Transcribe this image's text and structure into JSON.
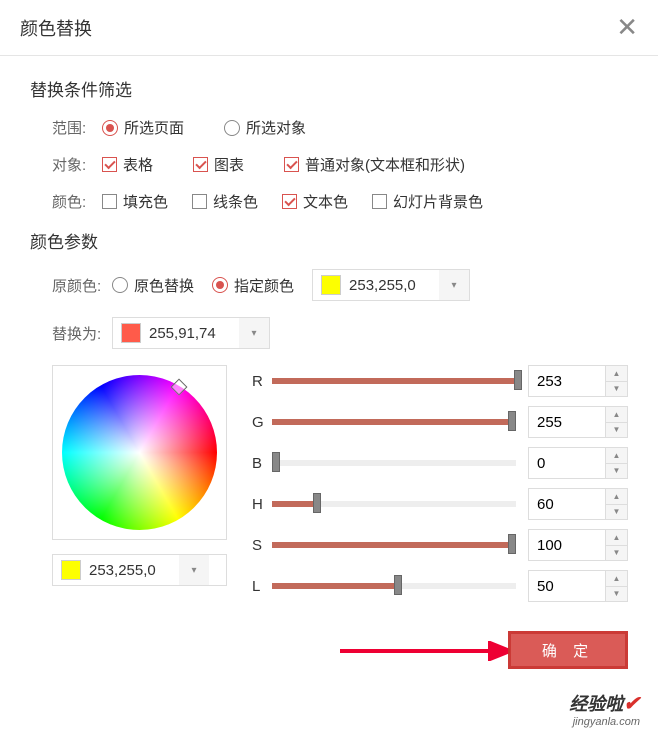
{
  "dialog": {
    "title": "颜色替换"
  },
  "filter": {
    "section_title": "替换条件筛选",
    "scope_label": "范围:",
    "scope_options": {
      "pages": "所选页面",
      "objects": "所选对象"
    },
    "object_label": "对象:",
    "object_options": {
      "table": "表格",
      "chart": "图表",
      "normal": "普通对象(文本框和形状)"
    },
    "color_label": "颜色:",
    "color_options": {
      "fill": "填充色",
      "line": "线条色",
      "text": "文本色",
      "bg": "幻灯片背景色"
    }
  },
  "params": {
    "section_title": "颜色参数",
    "original_label": "原颜色:",
    "original_options": {
      "replace_orig": "原色替换",
      "specify": "指定颜色"
    },
    "original_value": "253,255,0",
    "original_swatch": "#fdff00",
    "replace_label": "替换为:",
    "replace_value": "255,91,74",
    "replace_swatch": "#ff5b4a",
    "wheel_value": "253,255,0",
    "wheel_swatch": "#fdff00",
    "channels": {
      "R": {
        "label": "R",
        "value": "253",
        "pct": 99
      },
      "G": {
        "label": "G",
        "value": "255",
        "pct": 100
      },
      "B": {
        "label": "B",
        "value": "0",
        "pct": 0
      },
      "H": {
        "label": "H",
        "value": "60",
        "pct": 17
      },
      "S": {
        "label": "S",
        "value": "100",
        "pct": 100
      },
      "L": {
        "label": "L",
        "value": "50",
        "pct": 50
      }
    }
  },
  "footer": {
    "ok": "确 定"
  },
  "watermark": {
    "text": "经验啦",
    "url": "jingyanla.com"
  }
}
